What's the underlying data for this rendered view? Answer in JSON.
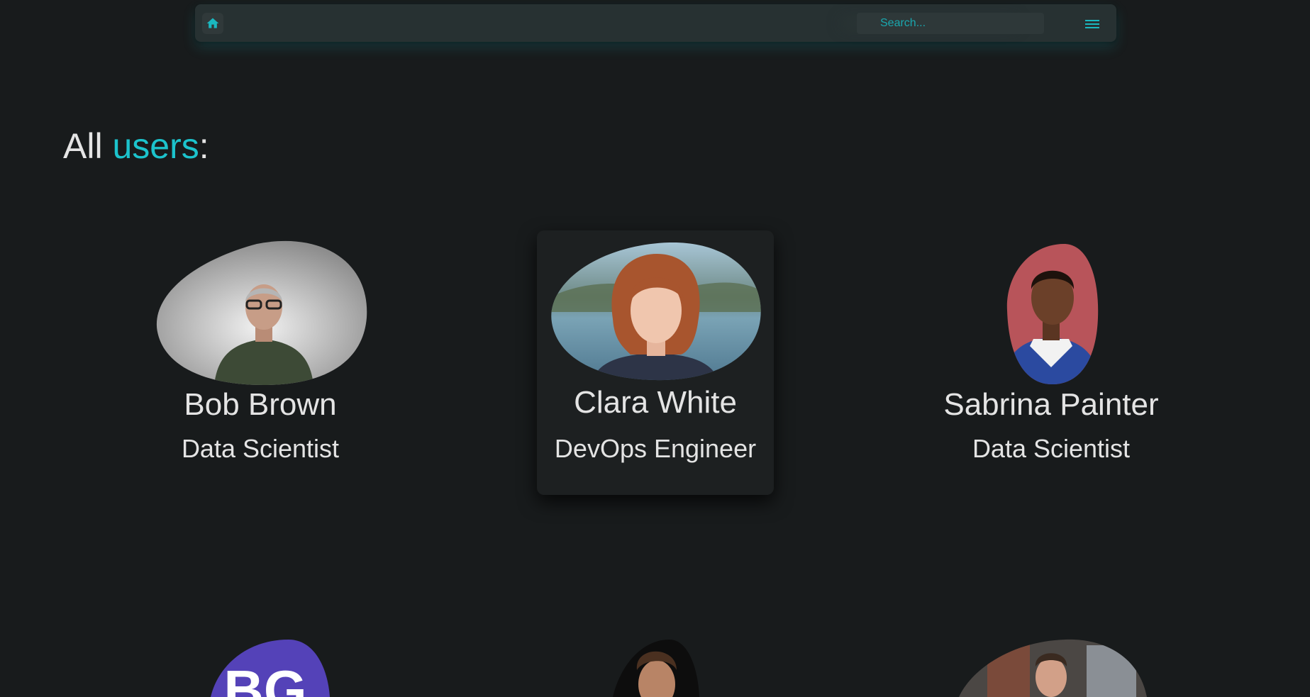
{
  "navbar": {
    "home_icon": "home-icon",
    "search_placeholder": "Search...",
    "menu_icon": "hamburger-menu-icon",
    "accent_color": "#1ab8c0"
  },
  "page": {
    "heading_prefix": "All ",
    "heading_accent": "users",
    "heading_suffix": ":",
    "accent_color": "#1cc3cc"
  },
  "users": [
    {
      "name": "Bob Brown",
      "role": "Data Scientist"
    },
    {
      "name": "Clara White",
      "role": "DevOps Engineer"
    },
    {
      "name": "Sabrina Painter",
      "role": "Data Scientist"
    },
    {
      "initials": "BG"
    }
  ]
}
